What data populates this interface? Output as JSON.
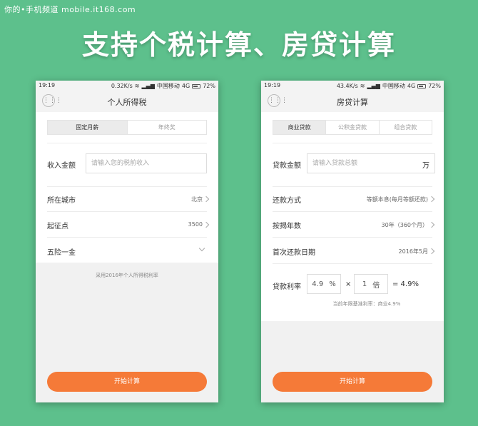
{
  "watermark": "你的•手机频道 mobile.it168.com",
  "headline": "支持个税计算、房贷计算",
  "left": {
    "status": {
      "time": "19:19",
      "speed": "0.32K/s",
      "carrier": "中国移动",
      "network": "4G",
      "battery": "72%"
    },
    "menu_icon": "⋮⋮⋮",
    "title": "个人所得税",
    "tabs": [
      "固定月薪",
      "年终奖"
    ],
    "income_label": "收入金额",
    "income_placeholder": "请输入您的税前收入",
    "city_label": "所在城市",
    "city_value": "北京",
    "threshold_label": "起征点",
    "threshold_value": "3500",
    "insurance_label": "五险一金",
    "note": "采用2016年个人所得税利率",
    "cta": "开始计算"
  },
  "right": {
    "status": {
      "time": "19:19",
      "speed": "43.4K/s",
      "carrier": "中国移动",
      "network": "4G",
      "battery": "72%"
    },
    "menu_icon": "⋮⋮⋮",
    "title": "房贷计算",
    "tabs": [
      "商业贷款",
      "公积金贷款",
      "组合贷款"
    ],
    "amount_label": "贷款金额",
    "amount_placeholder": "请输入贷款总额",
    "amount_unit": "万",
    "method_label": "还款方式",
    "method_value": "等额本息(每月等额还款)",
    "years_label": "按揭年数",
    "years_value": "30年（360个月）",
    "first_date_label": "首次还款日期",
    "first_date_value": "2016年5月",
    "rate_label": "贷款利率",
    "rate_base": "4.9",
    "rate_base_unit": "%",
    "times_sign": "×",
    "multiplier": "1",
    "multiplier_unit": "倍",
    "rate_result": "= 4.9%",
    "rate_note": "当前年限基准利率：商业4.9%",
    "cta": "开始计算"
  }
}
